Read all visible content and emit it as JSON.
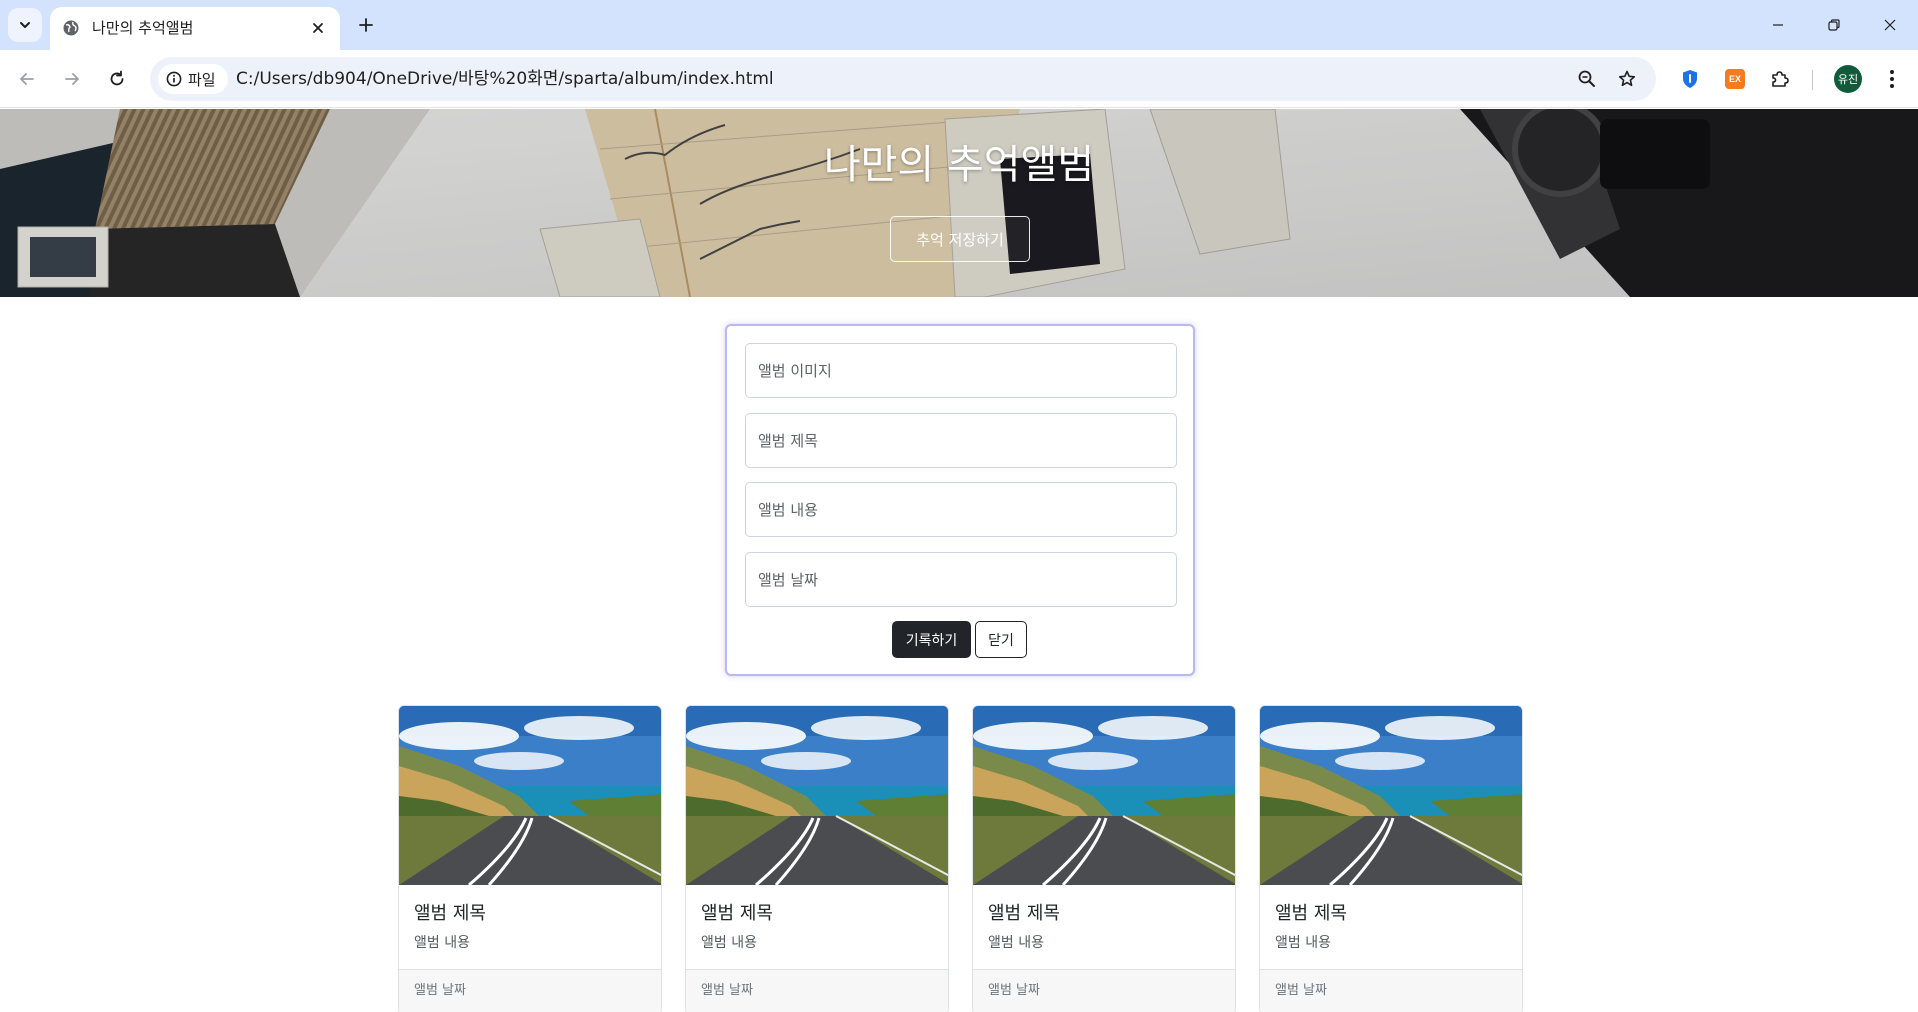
{
  "browser": {
    "tab_title": "나만의 추억앨범",
    "site_chip_label": "파일",
    "url": "C:/Users/db904/OneDrive/바탕%20화면/sparta/album/index.html",
    "profile_initials": "유진",
    "ext_badge_text": "EX"
  },
  "hero": {
    "title": "나만의 추억앨범",
    "button_label": "추억 저장하기"
  },
  "form": {
    "image_placeholder": "앨범 이미지",
    "title_placeholder": "앨범 제목",
    "content_placeholder": "앨범 내용",
    "date_placeholder": "앨범 날짜",
    "save_label": "기록하기",
    "close_label": "닫기"
  },
  "cards": [
    {
      "title": "앨범 제목",
      "text": "앨범 내용",
      "date": "앨범 날짜"
    },
    {
      "title": "앨범 제목",
      "text": "앨범 내용",
      "date": "앨범 날짜"
    },
    {
      "title": "앨범 제목",
      "text": "앨범 내용",
      "date": "앨범 날짜"
    },
    {
      "title": "앨범 제목",
      "text": "앨범 내용",
      "date": "앨범 날짜"
    }
  ],
  "colors": {
    "tabstrip": "#d3e3fd",
    "form_border": "#b9b9ee",
    "dark_button": "#212529"
  }
}
